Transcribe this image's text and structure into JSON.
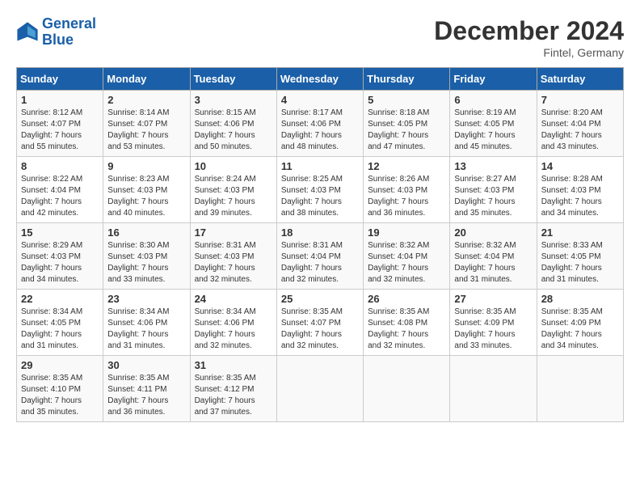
{
  "header": {
    "logo_line1": "General",
    "logo_line2": "Blue",
    "month": "December 2024",
    "location": "Fintel, Germany"
  },
  "days_of_week": [
    "Sunday",
    "Monday",
    "Tuesday",
    "Wednesday",
    "Thursday",
    "Friday",
    "Saturday"
  ],
  "weeks": [
    [
      {
        "day": 1,
        "info": "Sunrise: 8:12 AM\nSunset: 4:07 PM\nDaylight: 7 hours\nand 55 minutes."
      },
      {
        "day": 2,
        "info": "Sunrise: 8:14 AM\nSunset: 4:07 PM\nDaylight: 7 hours\nand 53 minutes."
      },
      {
        "day": 3,
        "info": "Sunrise: 8:15 AM\nSunset: 4:06 PM\nDaylight: 7 hours\nand 50 minutes."
      },
      {
        "day": 4,
        "info": "Sunrise: 8:17 AM\nSunset: 4:06 PM\nDaylight: 7 hours\nand 48 minutes."
      },
      {
        "day": 5,
        "info": "Sunrise: 8:18 AM\nSunset: 4:05 PM\nDaylight: 7 hours\nand 47 minutes."
      },
      {
        "day": 6,
        "info": "Sunrise: 8:19 AM\nSunset: 4:05 PM\nDaylight: 7 hours\nand 45 minutes."
      },
      {
        "day": 7,
        "info": "Sunrise: 8:20 AM\nSunset: 4:04 PM\nDaylight: 7 hours\nand 43 minutes."
      }
    ],
    [
      {
        "day": 8,
        "info": "Sunrise: 8:22 AM\nSunset: 4:04 PM\nDaylight: 7 hours\nand 42 minutes."
      },
      {
        "day": 9,
        "info": "Sunrise: 8:23 AM\nSunset: 4:03 PM\nDaylight: 7 hours\nand 40 minutes."
      },
      {
        "day": 10,
        "info": "Sunrise: 8:24 AM\nSunset: 4:03 PM\nDaylight: 7 hours\nand 39 minutes."
      },
      {
        "day": 11,
        "info": "Sunrise: 8:25 AM\nSunset: 4:03 PM\nDaylight: 7 hours\nand 38 minutes."
      },
      {
        "day": 12,
        "info": "Sunrise: 8:26 AM\nSunset: 4:03 PM\nDaylight: 7 hours\nand 36 minutes."
      },
      {
        "day": 13,
        "info": "Sunrise: 8:27 AM\nSunset: 4:03 PM\nDaylight: 7 hours\nand 35 minutes."
      },
      {
        "day": 14,
        "info": "Sunrise: 8:28 AM\nSunset: 4:03 PM\nDaylight: 7 hours\nand 34 minutes."
      }
    ],
    [
      {
        "day": 15,
        "info": "Sunrise: 8:29 AM\nSunset: 4:03 PM\nDaylight: 7 hours\nand 34 minutes."
      },
      {
        "day": 16,
        "info": "Sunrise: 8:30 AM\nSunset: 4:03 PM\nDaylight: 7 hours\nand 33 minutes."
      },
      {
        "day": 17,
        "info": "Sunrise: 8:31 AM\nSunset: 4:03 PM\nDaylight: 7 hours\nand 32 minutes."
      },
      {
        "day": 18,
        "info": "Sunrise: 8:31 AM\nSunset: 4:04 PM\nDaylight: 7 hours\nand 32 minutes."
      },
      {
        "day": 19,
        "info": "Sunrise: 8:32 AM\nSunset: 4:04 PM\nDaylight: 7 hours\nand 32 minutes."
      },
      {
        "day": 20,
        "info": "Sunrise: 8:32 AM\nSunset: 4:04 PM\nDaylight: 7 hours\nand 31 minutes."
      },
      {
        "day": 21,
        "info": "Sunrise: 8:33 AM\nSunset: 4:05 PM\nDaylight: 7 hours\nand 31 minutes."
      }
    ],
    [
      {
        "day": 22,
        "info": "Sunrise: 8:34 AM\nSunset: 4:05 PM\nDaylight: 7 hours\nand 31 minutes."
      },
      {
        "day": 23,
        "info": "Sunrise: 8:34 AM\nSunset: 4:06 PM\nDaylight: 7 hours\nand 31 minutes."
      },
      {
        "day": 24,
        "info": "Sunrise: 8:34 AM\nSunset: 4:06 PM\nDaylight: 7 hours\nand 32 minutes."
      },
      {
        "day": 25,
        "info": "Sunrise: 8:35 AM\nSunset: 4:07 PM\nDaylight: 7 hours\nand 32 minutes."
      },
      {
        "day": 26,
        "info": "Sunrise: 8:35 AM\nSunset: 4:08 PM\nDaylight: 7 hours\nand 32 minutes."
      },
      {
        "day": 27,
        "info": "Sunrise: 8:35 AM\nSunset: 4:09 PM\nDaylight: 7 hours\nand 33 minutes."
      },
      {
        "day": 28,
        "info": "Sunrise: 8:35 AM\nSunset: 4:09 PM\nDaylight: 7 hours\nand 34 minutes."
      }
    ],
    [
      {
        "day": 29,
        "info": "Sunrise: 8:35 AM\nSunset: 4:10 PM\nDaylight: 7 hours\nand 35 minutes."
      },
      {
        "day": 30,
        "info": "Sunrise: 8:35 AM\nSunset: 4:11 PM\nDaylight: 7 hours\nand 36 minutes."
      },
      {
        "day": 31,
        "info": "Sunrise: 8:35 AM\nSunset: 4:12 PM\nDaylight: 7 hours\nand 37 minutes."
      },
      null,
      null,
      null,
      null
    ]
  ]
}
